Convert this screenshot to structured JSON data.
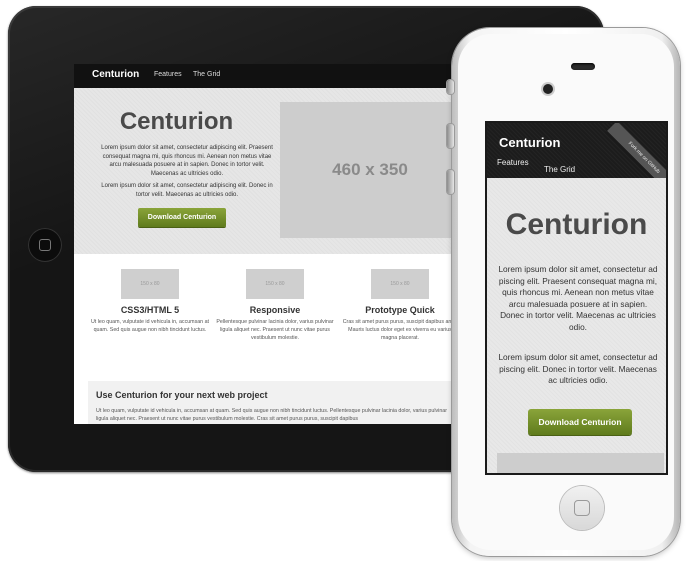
{
  "site": {
    "brand": "Centurion",
    "nav": [
      "Features",
      "The Grid"
    ],
    "hero_title": "Centurion",
    "hero_p1": "Lorem ipsum dolor sit amet, consectetur adipiscing elit. Praesent consequat magna mi, quis rhoncus mi. Aenean non metus vitae arcu malesuada posuere at in sapien. Donec in tortor velit. Maecenas ac ultricies odio.",
    "hero_p2": "Lorem ipsum dolor sit amet, consectetur adipiscing elit. Donec in tortor velit. Maecenas ac ultricies odio.",
    "cta": "Download Centurion",
    "hero_image_label": "460 x 350",
    "features": [
      {
        "thumb": "150 x 80",
        "title": "CSS3/HTML 5",
        "text": "Ut leo quam, vulputate id vehicula in, accumsan at quam. Sed quis augue non nibh tincidunt luctus."
      },
      {
        "thumb": "150 x 80",
        "title": "Responsive",
        "text": "Pellentesque pulvinar lacinia dolor, varius pulvinar ligula aliquet nec. Praesent ut nunc vitae purus vestibulum molestie."
      },
      {
        "thumb": "150 x 80",
        "title": "Prototype Quick",
        "text": "Cras sit amet purus purus, suscipit dapibus ante. Mauris luctus dolor eget ex viverra eu varius magna placerat."
      }
    ],
    "web_title": "Use Centurion for your next web project",
    "web_text": "Ut leo quam, vulputate id vehicula in, accumsan at quam. Sed quis augue non nibh tincidunt luctus. Pellentesque pulvinar lacinia dolor, varius pulvinar ligula aliquet nec. Praesent ut nunc vitae purus vestibulum molestie. Cras sit amet purus purus, suscipit dapibus"
  },
  "phone": {
    "brand": "Centurion",
    "nav": [
      "Features",
      "The Grid"
    ],
    "ribbon": "Fork me on GitHub",
    "hero_title": "Centurion",
    "hero_p1": "Lorem ipsum dolor sit amet, consectetur ad piscing elit. Praesent consequat magna mi, quis rhoncus mi. Aenean non metus vitae arcu malesuada posuere at in sapien. Donec in tortor velit. Maecenas ac ultricies odio.",
    "hero_p2": "Lorem ipsum dolor sit amet, consectetur ad piscing elit. Donec in tortor velit. Maecenas ac ultricies odio.",
    "cta": "Download Centurion"
  },
  "colors": {
    "button_green": "#6f8c24",
    "nav_dark": "#111111",
    "device_black": "#151515"
  }
}
